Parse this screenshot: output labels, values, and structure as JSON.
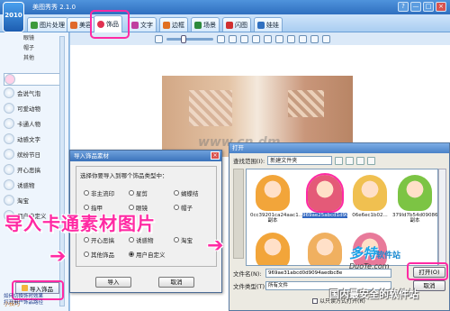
{
  "app": {
    "logo_text": "2010",
    "title": "美图秀秀 2.1.0",
    "window_buttons": [
      "?",
      "—",
      "□",
      "×"
    ]
  },
  "tabs": [
    {
      "label": "图片处理",
      "color": "#3c9a3c"
    },
    {
      "label": "美容",
      "color": "#e06a2a"
    },
    {
      "label": "饰品",
      "color": "#e03050",
      "active": true
    },
    {
      "label": "文字",
      "color": "#c040a0"
    },
    {
      "label": "边框",
      "color": "#e07020"
    },
    {
      "label": "场景",
      "color": "#2c8a3c"
    },
    {
      "label": "闪图",
      "color": "#d03030"
    },
    {
      "label": "娃娃",
      "color": "#3070c0"
    }
  ],
  "sidebar": {
    "top_items": [
      "眼镜",
      "帽子",
      "其他"
    ],
    "categories": [
      {
        "label": "会说气泡"
      },
      {
        "label": "可爱动物"
      },
      {
        "label": "卡通人物"
      },
      {
        "label": "动感文字"
      },
      {
        "label": "缤纷节日"
      },
      {
        "label": "开心恶搞"
      },
      {
        "label": "诱惑物"
      },
      {
        "label": "淘宝"
      },
      {
        "label": "用户自定义"
      }
    ],
    "import_button": "导入饰品",
    "tips_title": "小技巧",
    "tips": [
      "如何切换饰时效果",
      "打开用户饰品路径",
      "如何导入素材"
    ]
  },
  "import_dialog": {
    "title": "导入饰品素材",
    "close": "×",
    "prompt": "选择你要导入到哪个饰品类型中：",
    "options_col1": [
      "非主流印",
      "指甲",
      "开心恶搞",
      "其他饰品"
    ],
    "options_col2": [
      "星剪",
      "眼镜",
      "诱惑物",
      "用户自定义"
    ],
    "options_col3": [
      "蝴蝶结",
      "帽子",
      "淘宝"
    ],
    "selected": "用户自定义",
    "ok_button": "导入",
    "cancel_button": "取消"
  },
  "caption": "导入卡通素材图片",
  "watermark_text": "www.cn.dm",
  "open_dialog": {
    "title": "打开",
    "lookin_label": "查找范围(I):",
    "lookin_value": "新建文件夹",
    "files": [
      {
        "name": "0cc39201ca24aac1...",
        "sub": "副本",
        "color": "#f2a53a"
      },
      {
        "name": "969ae25abcd1d9094aedbc8e",
        "sub": "",
        "color": "#e45a78",
        "selected": true
      },
      {
        "name": "06e6ec1b02...",
        "sub": "",
        "color": "#f0c050"
      },
      {
        "name": "379ld7b54d09086...",
        "sub": "副本",
        "color": "#7cc444"
      },
      {
        "name": "",
        "sub": "",
        "color": "#f2a53a"
      },
      {
        "name": "",
        "sub": "",
        "color": "#f0b060"
      },
      {
        "name": "",
        "sub": "",
        "color": "#e87a9a"
      }
    ],
    "filename_label": "文件名(N):",
    "filename_value": "969ae31abcd0d9094aedbc8e",
    "filetype_label": "文件类型(T):",
    "filetype_value": "所有文件",
    "readonly_label": "以只读方式打开(R)",
    "open_button": "打开(O)",
    "cancel_button": "取消"
  },
  "brand": {
    "name": "多特",
    "name_suffix": "软件站",
    "sub": "DuoTe.com",
    "tag": "国内最安全的软件站"
  }
}
